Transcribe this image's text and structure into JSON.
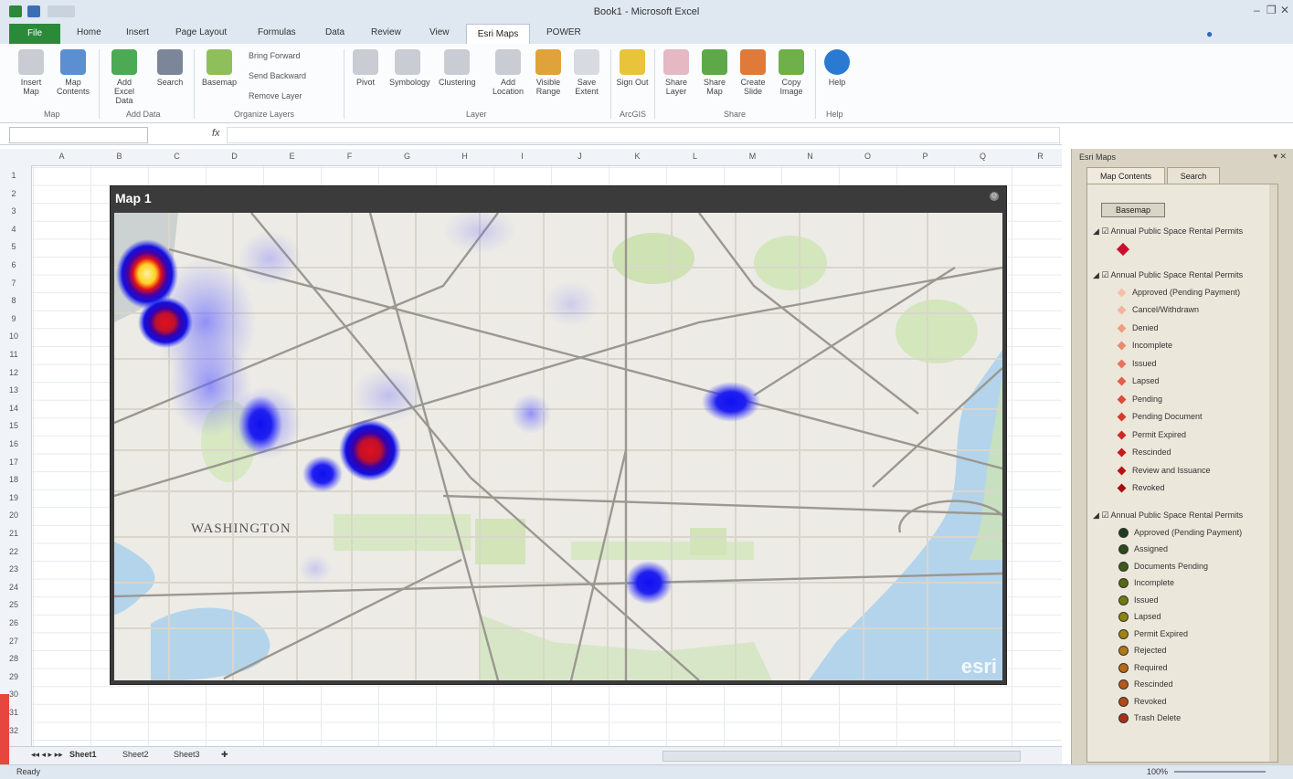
{
  "window": {
    "title": "Book1 - Microsoft Excel"
  },
  "ribbon": {
    "file_tab": "File",
    "tabs": [
      "Home",
      "Insert",
      "Page Layout",
      "Formulas",
      "Data",
      "Review",
      "View",
      "Esri Maps",
      "POWER"
    ],
    "active_tab": "Esri Maps",
    "buttons": [
      {
        "label": "Insert Map"
      },
      {
        "label": "Map Contents"
      },
      {
        "label": "Add Excel Data"
      },
      {
        "label": "Search"
      },
      {
        "label": "Basemap"
      },
      {
        "label": "Pivot"
      },
      {
        "label": "Symbology"
      },
      {
        "label": "Clustering"
      },
      {
        "label": "Add Location"
      },
      {
        "label": "Visible Range"
      },
      {
        "label": "Save Extent"
      },
      {
        "label": "Sign Out"
      },
      {
        "label": "Share Layer"
      },
      {
        "label": "Share Map"
      },
      {
        "label": "Create Slide"
      },
      {
        "label": "Copy Image"
      },
      {
        "label": "Help"
      }
    ],
    "small": [
      "Bring Forward",
      "Send Backward",
      "Remove Layer"
    ],
    "groups": [
      "Map",
      "Add Data",
      "Organize Layers",
      "Layer",
      "ArcGIS",
      "Share",
      "Help"
    ]
  },
  "formula": {
    "fx": "fx"
  },
  "sheet": {
    "columns": [
      "A",
      "B",
      "C",
      "D",
      "E",
      "F",
      "G",
      "H",
      "I",
      "J",
      "K",
      "L",
      "M",
      "N",
      "O",
      "P",
      "Q",
      "R"
    ],
    "rows": [
      "1",
      "2",
      "3",
      "4",
      "5",
      "6",
      "7",
      "8",
      "9",
      "10",
      "11",
      "12",
      "13",
      "14",
      "15",
      "16",
      "17",
      "18",
      "19",
      "20",
      "21",
      "22",
      "23",
      "24",
      "25",
      "26",
      "27",
      "28",
      "29",
      "30",
      "31",
      "32"
    ],
    "tabs": [
      "Sheet1",
      "Sheet2",
      "Sheet3"
    ]
  },
  "map": {
    "title": "Map 1",
    "city_label": "WASHINGTON",
    "logo": "esri"
  },
  "panel": {
    "title": "Esri Maps",
    "tabs": [
      "Map Contents",
      "Search"
    ],
    "basemap_button": "Basemap",
    "layers": [
      {
        "name": "Annual Public Space Rental Permits",
        "items": [
          {
            "label": "",
            "color": "#c8102e"
          }
        ]
      },
      {
        "name": "Annual Public Space Rental Permits",
        "items": [
          {
            "label": "Approved (Pending Payment)",
            "color": "#f4c0a8"
          },
          {
            "label": "Cancel/Withdrawn",
            "color": "#f1b59c"
          },
          {
            "label": "Denied",
            "color": "#ee9e82"
          },
          {
            "label": "Incomplete",
            "color": "#ea8a6f"
          },
          {
            "label": "Issued",
            "color": "#e5745b"
          },
          {
            "label": "Lapsed",
            "color": "#e06049"
          },
          {
            "label": "Pending",
            "color": "#da4c3a"
          },
          {
            "label": "Pending Document",
            "color": "#d43a2d"
          },
          {
            "label": "Permit Expired",
            "color": "#cc2a22"
          },
          {
            "label": "Rescinded",
            "color": "#c21c1a"
          },
          {
            "label": "Review and Issuance",
            "color": "#b51414"
          },
          {
            "label": "Revoked",
            "color": "#a60e0f"
          }
        ]
      },
      {
        "name": "Annual Public Space Rental Permits",
        "items": [
          {
            "label": "Approved (Pending Payment)",
            "color": "#1e3b1e"
          },
          {
            "label": "Assigned",
            "color": "#2a4a1c"
          },
          {
            "label": "Documents Pending",
            "color": "#3d5a1a"
          },
          {
            "label": "Incomplete",
            "color": "#566a14"
          },
          {
            "label": "Issued",
            "color": "#707a10"
          },
          {
            "label": "Lapsed",
            "color": "#8a8410"
          },
          {
            "label": "Permit Expired",
            "color": "#a08410"
          },
          {
            "label": "Rejected",
            "color": "#b07a12"
          },
          {
            "label": "Required",
            "color": "#b86a14"
          },
          {
            "label": "Rescinded",
            "color": "#b85a16"
          },
          {
            "label": "Revoked",
            "color": "#b04a18"
          },
          {
            "label": "Trash Delete",
            "color": "#a8301a"
          }
        ]
      }
    ]
  },
  "status": {
    "text": "Ready",
    "zoom": "100%"
  }
}
